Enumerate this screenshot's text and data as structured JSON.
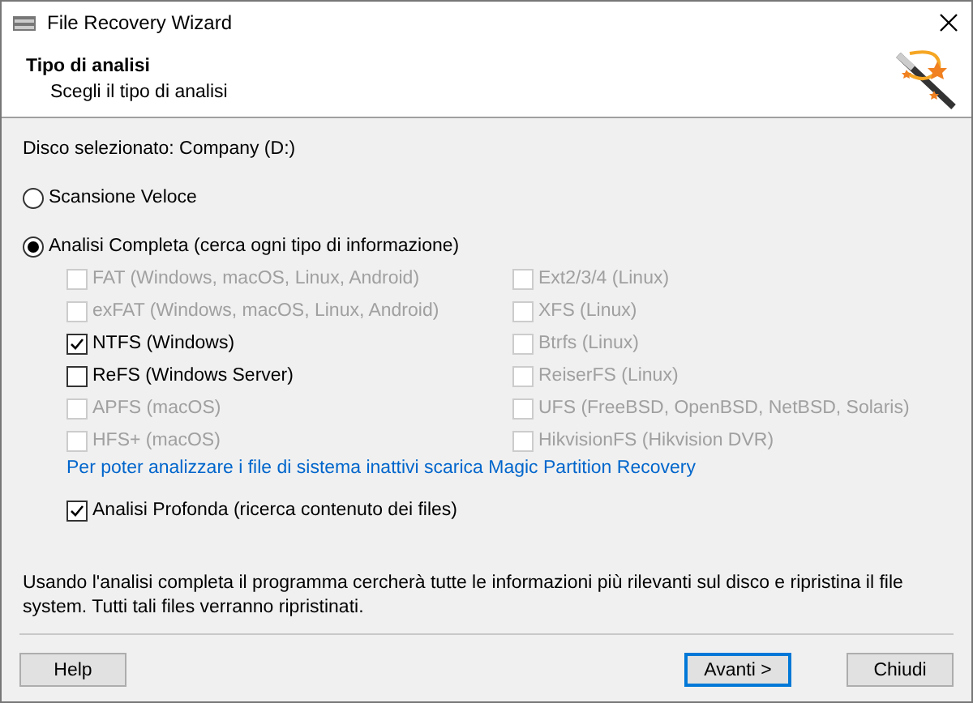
{
  "window": {
    "title": "File Recovery Wizard"
  },
  "header": {
    "title": "Tipo di analisi",
    "subtitle": "Scegli il tipo di analisi"
  },
  "disk_label": "Disco selezionato: Company (D:)",
  "scan_options": [
    {
      "label": "Scansione Veloce",
      "selected": false
    },
    {
      "label": "Analisi Completa (cerca ogni tipo di informazione)",
      "selected": true
    }
  ],
  "filesystems_left": [
    {
      "label": "FAT (Windows, macOS, Linux, Android)",
      "checked": false,
      "disabled": true
    },
    {
      "label": "exFAT (Windows, macOS, Linux, Android)",
      "checked": false,
      "disabled": true
    },
    {
      "label": "NTFS (Windows)",
      "checked": true,
      "disabled": false
    },
    {
      "label": "ReFS (Windows Server)",
      "checked": false,
      "disabled": false
    },
    {
      "label": "APFS (macOS)",
      "checked": false,
      "disabled": true
    },
    {
      "label": "HFS+ (macOS)",
      "checked": false,
      "disabled": true
    }
  ],
  "filesystems_right": [
    {
      "label": "Ext2/3/4 (Linux)",
      "checked": false,
      "disabled": true
    },
    {
      "label": "XFS (Linux)",
      "checked": false,
      "disabled": true
    },
    {
      "label": "Btrfs (Linux)",
      "checked": false,
      "disabled": true
    },
    {
      "label": "ReiserFS (Linux)",
      "checked": false,
      "disabled": true
    },
    {
      "label": "UFS (FreeBSD, OpenBSD, NetBSD, Solaris)",
      "checked": false,
      "disabled": true
    },
    {
      "label": "HikvisionFS (Hikvision DVR)",
      "checked": false,
      "disabled": true
    }
  ],
  "link": "Per poter analizzare i file di sistema inattivi scarica Magic Partition Recovery",
  "deep_scan": {
    "label": "Analisi Profonda (ricerca contenuto dei files)",
    "checked": true
  },
  "description": "Usando l'analisi completa il programma cercherà tutte le informazioni più rilevanti sul disco e ripristina il file system. Tutti tali files verranno ripristinati.",
  "buttons": [
    {
      "label": "Help",
      "default": false
    },
    {
      "label": "Avanti >",
      "default": true
    },
    {
      "label": "Chiudi",
      "default": false
    }
  ]
}
